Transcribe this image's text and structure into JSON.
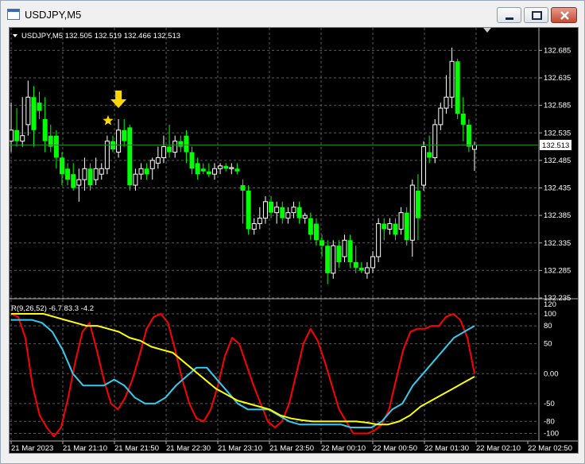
{
  "window": {
    "title": "USDJPY,M5",
    "buttons": [
      "minimize",
      "restore",
      "close"
    ]
  },
  "main_chart": {
    "header_label": "USDJPY,M5  132.505 132.519 132.466 132.513",
    "current_price_label": "132.513",
    "price_ticks": [
      "132.685",
      "132.635",
      "132.585",
      "132.535",
      "132.485",
      "132.435",
      "132.385",
      "132.335",
      "132.285",
      "132.235"
    ]
  },
  "indicator": {
    "header_label": "R(9,26,52) -6.7 83.3 -4.2",
    "level_ticks": [
      "120",
      "100",
      "80",
      "50",
      "0.00",
      "-50",
      "-80",
      "-100"
    ]
  },
  "time_axis": [
    "21 Mar 2023",
    "21 Mar 21:10",
    "21 Mar 21:50",
    "21 Mar 22:30",
    "21 Mar 23:10",
    "21 Mar 23:50",
    "22 Mar 00:10",
    "22 Mar 00:50",
    "22 Mar 01:30",
    "22 Mar 02:10",
    "22 Mar 02:50"
  ],
  "colors": {
    "background": "#000000",
    "bull_candle": "#ffffff",
    "bear_candle": "#00ff00",
    "grid": "#5a5a5a",
    "arrow_and_star": "#ffd700",
    "fast_line": "#ff0000",
    "medium_line": "#33ccee",
    "slow_line": "#ffff00"
  },
  "chart_data": {
    "type": "candlestick",
    "ylim": [
      132.235,
      132.7
    ],
    "current_price": 132.513,
    "candles": [
      {
        "o": 132.52,
        "h": 132.59,
        "l": 132.5,
        "c": 132.54
      },
      {
        "o": 132.54,
        "h": 132.58,
        "l": 132.51,
        "c": 132.52
      },
      {
        "o": 132.52,
        "h": 132.6,
        "l": 132.51,
        "c": 132.53
      },
      {
        "o": 132.55,
        "h": 132.63,
        "l": 132.53,
        "c": 132.6
      },
      {
        "o": 132.6,
        "h": 132.62,
        "l": 132.51,
        "c": 132.54
      },
      {
        "o": 132.59,
        "h": 132.61,
        "l": 132.56,
        "c": 132.575
      },
      {
        "o": 132.56,
        "h": 132.6,
        "l": 132.5,
        "c": 132.52
      },
      {
        "o": 132.53,
        "h": 132.55,
        "l": 132.5,
        "c": 132.51
      },
      {
        "o": 132.53,
        "h": 132.54,
        "l": 132.47,
        "c": 132.49
      },
      {
        "o": 132.49,
        "h": 132.5,
        "l": 132.44,
        "c": 132.46
      },
      {
        "o": 132.47,
        "h": 132.48,
        "l": 132.44,
        "c": 132.45
      },
      {
        "o": 132.46,
        "h": 132.48,
        "l": 132.43,
        "c": 132.435
      },
      {
        "o": 132.44,
        "h": 132.47,
        "l": 132.41,
        "c": 132.45
      },
      {
        "o": 132.45,
        "h": 132.49,
        "l": 132.43,
        "c": 132.47
      },
      {
        "o": 132.47,
        "h": 132.48,
        "l": 132.43,
        "c": 132.44
      },
      {
        "o": 132.45,
        "h": 132.49,
        "l": 132.44,
        "c": 132.47
      },
      {
        "o": 132.46,
        "h": 132.48,
        "l": 132.45,
        "c": 132.47
      },
      {
        "o": 132.47,
        "h": 132.53,
        "l": 132.46,
        "c": 132.52
      },
      {
        "o": 132.52,
        "h": 132.53,
        "l": 132.5,
        "c": 132.505
      },
      {
        "o": 132.5,
        "h": 132.56,
        "l": 132.49,
        "c": 132.54
      },
      {
        "o": 132.54,
        "h": 132.56,
        "l": 132.51,
        "c": 132.52
      },
      {
        "o": 132.545,
        "h": 132.55,
        "l": 132.43,
        "c": 132.44
      },
      {
        "o": 132.44,
        "h": 132.47,
        "l": 132.43,
        "c": 132.46
      },
      {
        "o": 132.46,
        "h": 132.48,
        "l": 132.45,
        "c": 132.47
      },
      {
        "o": 132.47,
        "h": 132.48,
        "l": 132.45,
        "c": 132.46
      },
      {
        "o": 132.47,
        "h": 132.49,
        "l": 132.45,
        "c": 132.485
      },
      {
        "o": 132.48,
        "h": 132.51,
        "l": 132.47,
        "c": 132.49
      },
      {
        "o": 132.49,
        "h": 132.53,
        "l": 132.48,
        "c": 132.51
      },
      {
        "o": 132.51,
        "h": 132.55,
        "l": 132.49,
        "c": 132.5
      },
      {
        "o": 132.5,
        "h": 132.53,
        "l": 132.49,
        "c": 132.52
      },
      {
        "o": 132.52,
        "h": 132.53,
        "l": 132.5,
        "c": 132.51
      },
      {
        "o": 132.53,
        "h": 132.54,
        "l": 132.48,
        "c": 132.5
      },
      {
        "o": 132.5,
        "h": 132.51,
        "l": 132.46,
        "c": 132.47
      },
      {
        "o": 132.48,
        "h": 132.49,
        "l": 132.45,
        "c": 132.46
      },
      {
        "o": 132.47,
        "h": 132.48,
        "l": 132.46,
        "c": 132.465
      },
      {
        "o": 132.465,
        "h": 132.48,
        "l": 132.455,
        "c": 132.46
      },
      {
        "o": 132.46,
        "h": 132.48,
        "l": 132.45,
        "c": 132.47
      },
      {
        "o": 132.47,
        "h": 132.48,
        "l": 132.46,
        "c": 132.475
      },
      {
        "o": 132.475,
        "h": 132.48,
        "l": 132.465,
        "c": 132.47
      },
      {
        "o": 132.47,
        "h": 132.48,
        "l": 132.46,
        "c": 132.472
      },
      {
        "o": 132.47,
        "h": 132.48,
        "l": 132.46,
        "c": 132.465
      },
      {
        "o": 132.44,
        "h": 132.45,
        "l": 132.37,
        "c": 132.43
      },
      {
        "o": 132.43,
        "h": 132.44,
        "l": 132.35,
        "c": 132.36
      },
      {
        "o": 132.36,
        "h": 132.38,
        "l": 132.35,
        "c": 132.37
      },
      {
        "o": 132.37,
        "h": 132.4,
        "l": 132.36,
        "c": 132.38
      },
      {
        "o": 132.38,
        "h": 132.42,
        "l": 132.37,
        "c": 132.41
      },
      {
        "o": 132.41,
        "h": 132.42,
        "l": 132.38,
        "c": 132.39
      },
      {
        "o": 132.39,
        "h": 132.41,
        "l": 132.37,
        "c": 132.4
      },
      {
        "o": 132.4,
        "h": 132.41,
        "l": 132.37,
        "c": 132.38
      },
      {
        "o": 132.38,
        "h": 132.4,
        "l": 132.37,
        "c": 132.39
      },
      {
        "o": 132.39,
        "h": 132.41,
        "l": 132.38,
        "c": 132.4
      },
      {
        "o": 132.4,
        "h": 132.41,
        "l": 132.37,
        "c": 132.38
      },
      {
        "o": 132.38,
        "h": 132.39,
        "l": 132.37,
        "c": 132.385
      },
      {
        "o": 132.38,
        "h": 132.39,
        "l": 132.34,
        "c": 132.35
      },
      {
        "o": 132.37,
        "h": 132.38,
        "l": 132.33,
        "c": 132.34
      },
      {
        "o": 132.34,
        "h": 132.35,
        "l": 132.31,
        "c": 132.33
      },
      {
        "o": 132.33,
        "h": 132.34,
        "l": 132.26,
        "c": 132.28
      },
      {
        "o": 132.28,
        "h": 132.34,
        "l": 132.27,
        "c": 132.33
      },
      {
        "o": 132.33,
        "h": 132.34,
        "l": 132.29,
        "c": 132.3
      },
      {
        "o": 132.31,
        "h": 132.35,
        "l": 132.3,
        "c": 132.34
      },
      {
        "o": 132.34,
        "h": 132.35,
        "l": 132.29,
        "c": 132.3
      },
      {
        "o": 132.3,
        "h": 132.33,
        "l": 132.28,
        "c": 132.29
      },
      {
        "o": 132.29,
        "h": 132.3,
        "l": 132.28,
        "c": 132.285
      },
      {
        "o": 132.28,
        "h": 132.3,
        "l": 132.27,
        "c": 132.29
      },
      {
        "o": 132.29,
        "h": 132.32,
        "l": 132.28,
        "c": 132.31
      },
      {
        "o": 132.31,
        "h": 132.38,
        "l": 132.3,
        "c": 132.37
      },
      {
        "o": 132.37,
        "h": 132.38,
        "l": 132.34,
        "c": 132.36
      },
      {
        "o": 132.36,
        "h": 132.38,
        "l": 132.35,
        "c": 132.37
      },
      {
        "o": 132.37,
        "h": 132.38,
        "l": 132.34,
        "c": 132.35
      },
      {
        "o": 132.36,
        "h": 132.4,
        "l": 132.35,
        "c": 132.39
      },
      {
        "o": 132.39,
        "h": 132.4,
        "l": 132.33,
        "c": 132.34
      },
      {
        "o": 132.34,
        "h": 132.45,
        "l": 132.31,
        "c": 132.44
      },
      {
        "o": 132.43,
        "h": 132.46,
        "l": 132.34,
        "c": 132.38
      },
      {
        "o": 132.44,
        "h": 132.52,
        "l": 132.43,
        "c": 132.51
      },
      {
        "o": 132.5,
        "h": 132.53,
        "l": 132.48,
        "c": 132.49
      },
      {
        "o": 132.49,
        "h": 132.56,
        "l": 132.48,
        "c": 132.55
      },
      {
        "o": 132.55,
        "h": 132.59,
        "l": 132.54,
        "c": 132.58
      },
      {
        "o": 132.58,
        "h": 132.64,
        "l": 132.57,
        "c": 132.6
      },
      {
        "o": 132.6,
        "h": 132.69,
        "l": 132.58,
        "c": 132.665
      },
      {
        "o": 132.665,
        "h": 132.67,
        "l": 132.56,
        "c": 132.57
      },
      {
        "o": 132.57,
        "h": 132.6,
        "l": 132.52,
        "c": 132.55
      },
      {
        "o": 132.55,
        "h": 132.56,
        "l": 132.5,
        "c": 132.51
      },
      {
        "o": 132.505,
        "h": 132.519,
        "l": 132.466,
        "c": 132.513
      }
    ],
    "signal_candle_index": 19,
    "indicator": {
      "ylim": [
        -110,
        120
      ],
      "levels": [
        100,
        80,
        50,
        0,
        -50,
        -80,
        -100
      ],
      "series": [
        {
          "values": [
            100,
            95,
            60,
            -20,
            -70,
            -90,
            -105,
            -90,
            -40,
            20,
            70,
            85,
            40,
            -10,
            -50,
            -60,
            -40,
            -10,
            30,
            75,
            95,
            100,
            85,
            40,
            -10,
            -50,
            -75,
            -80,
            -60,
            -20,
            30,
            60,
            50,
            15,
            -20,
            -50,
            -80,
            -90,
            -80,
            -50,
            0,
            50,
            75,
            55,
            20,
            -20,
            -60,
            -80,
            -100,
            -100,
            -100,
            -95,
            -85,
            -60,
            -10,
            40,
            70,
            75,
            75,
            80,
            80,
            95,
            100,
            90,
            60,
            0
          ]
        },
        {
          "values": [
            90,
            90,
            90,
            85,
            70,
            40,
            0,
            -20,
            -20,
            -20,
            -10,
            -20,
            -40,
            -50,
            -50,
            -40,
            -20,
            -5,
            10,
            10,
            -10,
            -30,
            -50,
            -60,
            -60,
            -60,
            -70,
            -80,
            -85,
            -85,
            -85,
            -85,
            -85,
            -90,
            -90,
            -90,
            -80,
            -60,
            -50,
            -20,
            0,
            20,
            40,
            60,
            70,
            80
          ]
        },
        {
          "values": [
            100,
            100,
            100,
            100,
            95,
            90,
            85,
            80,
            80,
            75,
            70,
            60,
            55,
            45,
            40,
            35,
            20,
            5,
            -10,
            -25,
            -35,
            -45,
            -50,
            -55,
            -60,
            -70,
            -75,
            -78,
            -80,
            -80,
            -80,
            -80,
            -80,
            -82,
            -85,
            -85,
            -80,
            -70,
            -55,
            -45,
            -35,
            -25,
            -15,
            -5
          ]
        }
      ]
    }
  }
}
